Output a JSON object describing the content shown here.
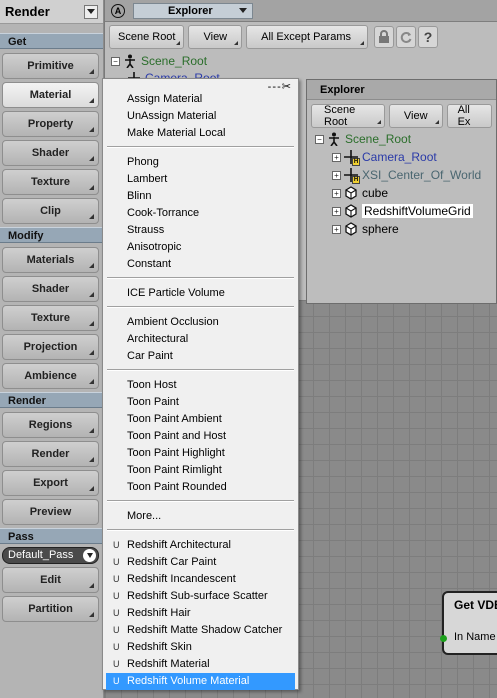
{
  "left_panel": {
    "title": "Render",
    "sections": [
      {
        "header": "Get",
        "buttons": [
          "Primitive",
          "Material",
          "Property",
          "Shader",
          "Texture",
          "Clip"
        ]
      },
      {
        "header": "Modify",
        "buttons": [
          "Materials",
          "Shader",
          "Texture",
          "Projection",
          "Ambience"
        ]
      },
      {
        "header": "Render",
        "buttons": [
          "Regions",
          "Render",
          "Export",
          "Preview"
        ]
      },
      {
        "header": "Pass",
        "pass_value": "Default_Pass",
        "buttons": [
          "Edit",
          "Partition"
        ]
      }
    ]
  },
  "explorer_back": {
    "badge": "A",
    "tab_label": "Explorer",
    "toolbar": [
      "Scene Root",
      "View",
      "All Except Params"
    ],
    "tree": [
      "Scene_Root",
      "Camera_Root"
    ]
  },
  "explorer_front": {
    "title": "Explorer",
    "toolbar": [
      "Scene Root",
      "View",
      "All Ex"
    ],
    "tree": [
      {
        "label": "Scene_Root",
        "type": "root"
      },
      {
        "label": "Camera_Root",
        "type": "nullH"
      },
      {
        "label": "XSI_Center_Of_World",
        "type": "nullH"
      },
      {
        "label": "cube",
        "type": "poly"
      },
      {
        "label": "RedshiftVolumeGrid",
        "type": "poly"
      },
      {
        "label": "sphere",
        "type": "poly"
      }
    ]
  },
  "context_menu": {
    "groups": [
      [
        "Assign Material",
        "UnAssign Material",
        "Make Material Local"
      ],
      [
        "Phong",
        "Lambert",
        "Blinn",
        "Cook-Torrance",
        "Strauss",
        "Anisotropic",
        "Constant"
      ],
      [
        "ICE Particle Volume"
      ],
      [
        "Ambient Occlusion",
        "Architectural",
        "Car Paint"
      ],
      [
        "Toon Host",
        "Toon Paint",
        "Toon Paint Ambient",
        "Toon Paint and Host",
        "Toon Paint Highlight",
        "Toon Paint Rimlight",
        "Toon Paint Rounded"
      ],
      [
        "More..."
      ],
      [
        "Redshift Architectural",
        "Redshift Car Paint",
        "Redshift Incandescent",
        "Redshift Sub-surface Scatter",
        "Redshift Hair",
        "Redshift Matte Shadow Catcher",
        "Redshift Skin",
        "Redshift Material",
        "Redshift Volume Material"
      ]
    ],
    "redshift_marker": "U",
    "selected_item": "Redshift Volume Material"
  },
  "node": {
    "title": "Get VDB",
    "port": "In Name"
  },
  "colors": {
    "menu_highlight": "#3399ff",
    "section_header": "#96a7b6",
    "root_green": "#2b6e2b",
    "camera_blue": "#2a3aa8"
  }
}
